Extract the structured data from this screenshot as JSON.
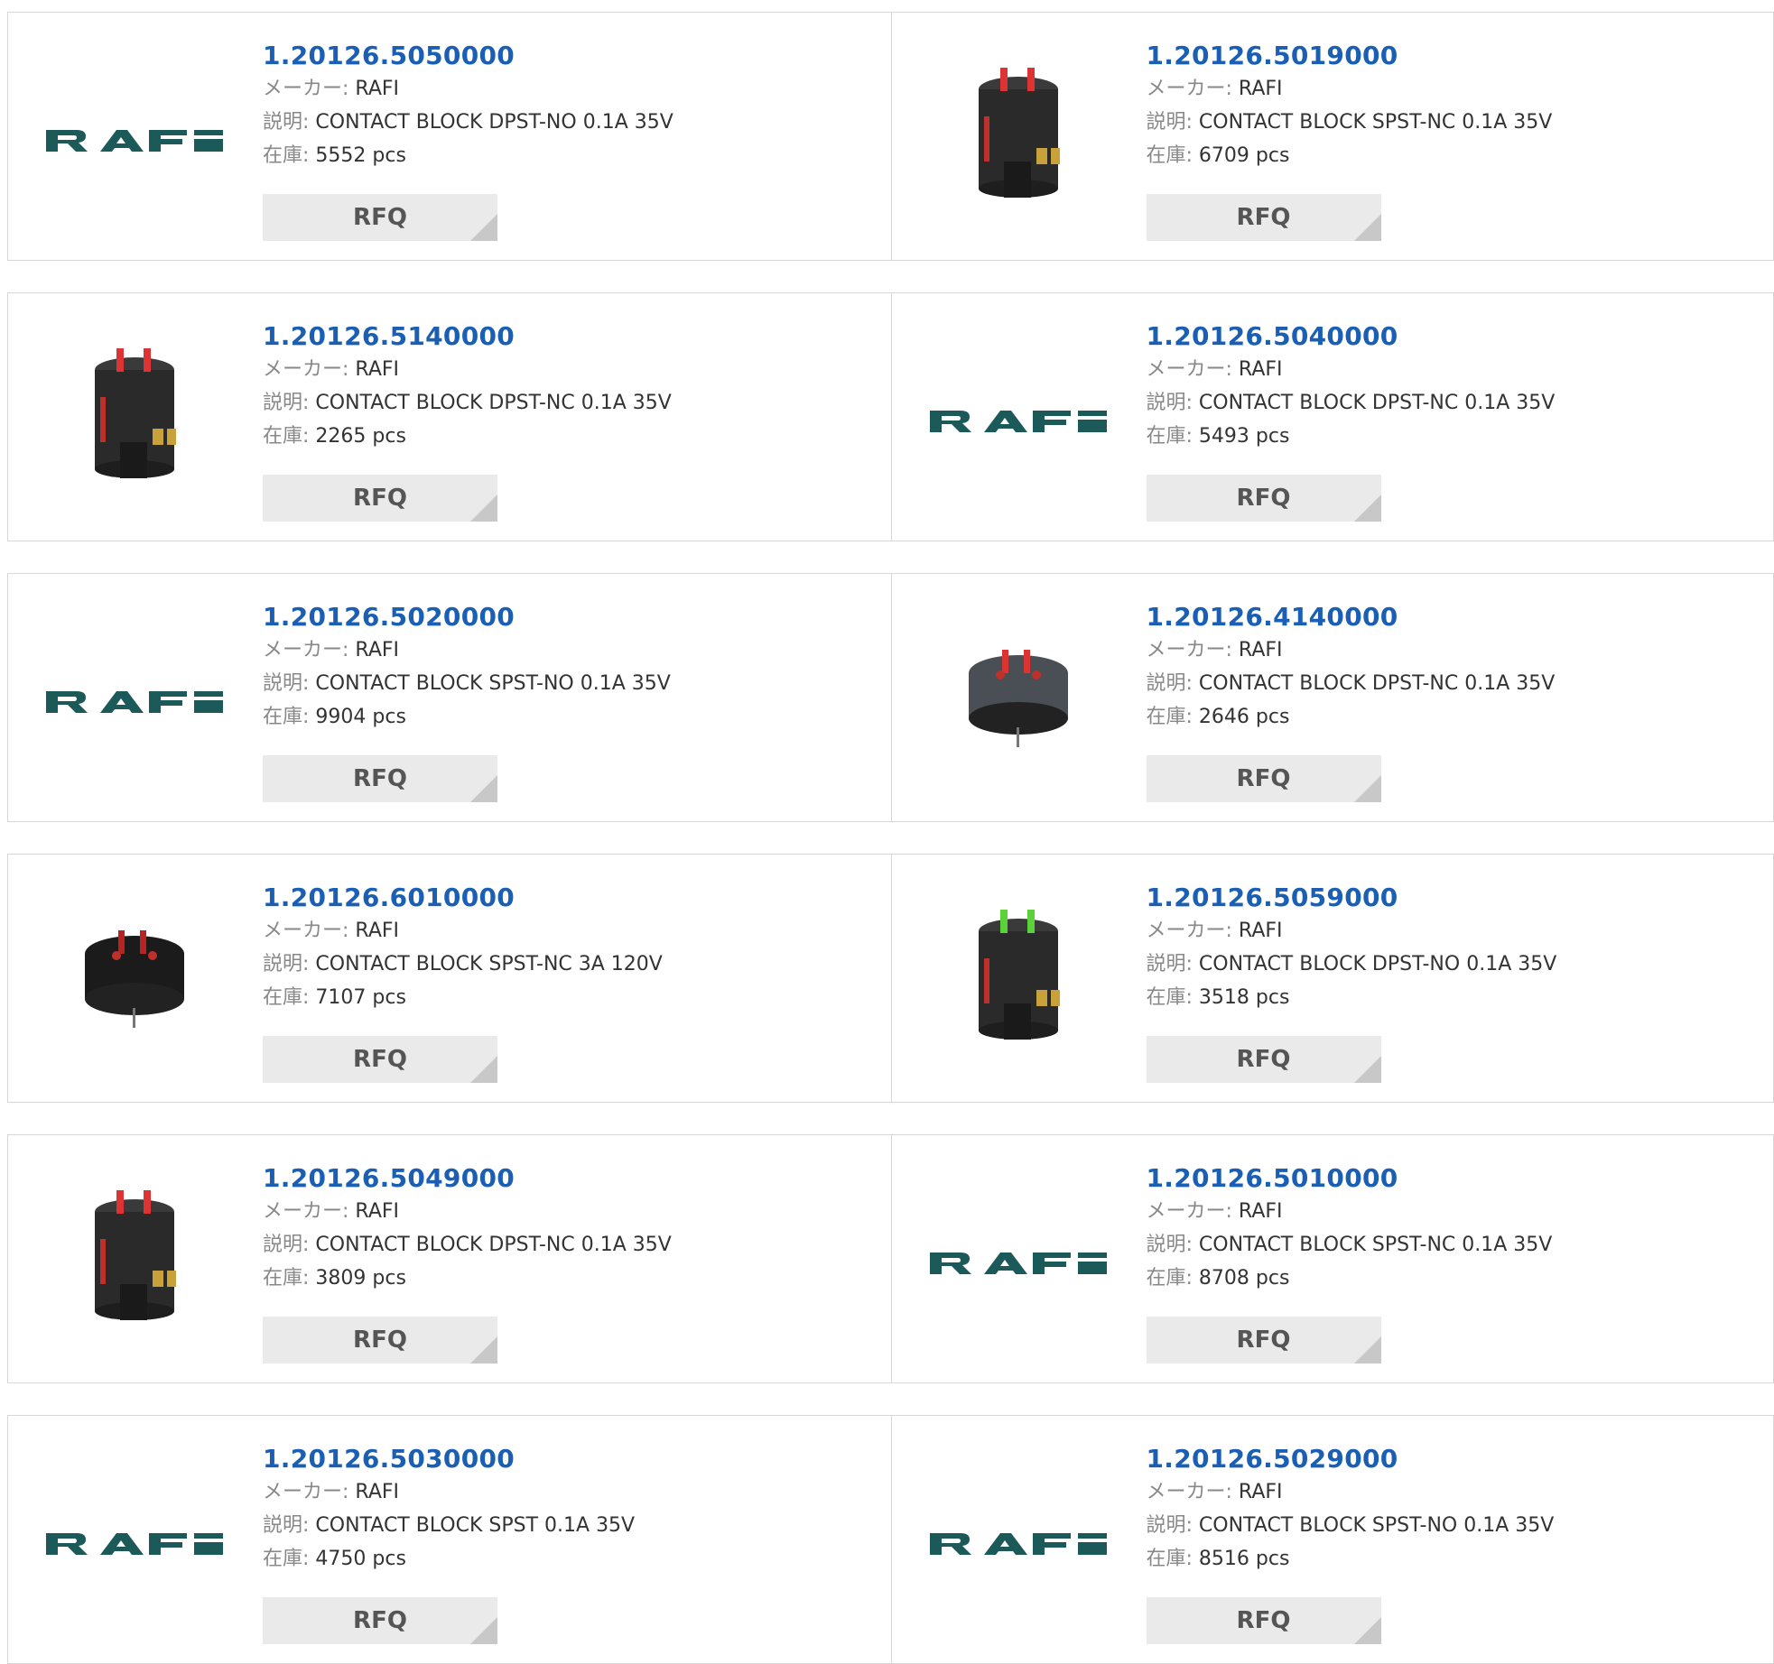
{
  "labels": {
    "maker": "メーカー:",
    "desc": "説明:",
    "stock": "在庫:",
    "rfq": "RFQ"
  },
  "colors": {
    "link": "#1a5fb4",
    "logo": "#1c5a5a",
    "rfq_bg": "#eaeaea"
  },
  "products": [
    {
      "pn": "1.20126.5050000",
      "maker": "RAFI",
      "desc": "CONTACT BLOCK DPST-NO 0.1A 35V",
      "stock": "5552 pcs",
      "image": "rafi-logo"
    },
    {
      "pn": "1.20126.5019000",
      "maker": "RAFI",
      "desc": "CONTACT BLOCK SPST-NC 0.1A 35V",
      "stock": "6709 pcs",
      "image": "contact-block-tall-red"
    },
    {
      "pn": "1.20126.5140000",
      "maker": "RAFI",
      "desc": "CONTACT BLOCK DPST-NC 0.1A 35V",
      "stock": "2265 pcs",
      "image": "contact-block-tall-red"
    },
    {
      "pn": "1.20126.5040000",
      "maker": "RAFI",
      "desc": "CONTACT BLOCK DPST-NC 0.1A 35V",
      "stock": "5493 pcs",
      "image": "rafi-logo"
    },
    {
      "pn": "1.20126.5020000",
      "maker": "RAFI",
      "desc": "CONTACT BLOCK SPST-NO 0.1A 35V",
      "stock": "9904 pcs",
      "image": "rafi-logo"
    },
    {
      "pn": "1.20126.4140000",
      "maker": "RAFI",
      "desc": "CONTACT BLOCK DPST-NC 0.1A 35V",
      "stock": "2646 pcs",
      "image": "contact-block-round-grey"
    },
    {
      "pn": "1.20126.6010000",
      "maker": "RAFI",
      "desc": "CONTACT BLOCK SPST-NC 3A 120V",
      "stock": "7107 pcs",
      "image": "contact-block-round-black"
    },
    {
      "pn": "1.20126.5059000",
      "maker": "RAFI",
      "desc": "CONTACT BLOCK DPST-NO 0.1A 35V",
      "stock": "3518 pcs",
      "image": "contact-block-tall-green"
    },
    {
      "pn": "1.20126.5049000",
      "maker": "RAFI",
      "desc": "CONTACT BLOCK DPST-NC 0.1A 35V",
      "stock": "3809 pcs",
      "image": "contact-block-tall-red"
    },
    {
      "pn": "1.20126.5010000",
      "maker": "RAFI",
      "desc": "CONTACT BLOCK SPST-NC 0.1A 35V",
      "stock": "8708 pcs",
      "image": "rafi-logo"
    },
    {
      "pn": "1.20126.5030000",
      "maker": "RAFI",
      "desc": "CONTACT BLOCK SPST 0.1A 35V",
      "stock": "4750 pcs",
      "image": "rafi-logo"
    },
    {
      "pn": "1.20126.5029000",
      "maker": "RAFI",
      "desc": "CONTACT BLOCK SPST-NO 0.1A 35V",
      "stock": "8516 pcs",
      "image": "rafi-logo"
    }
  ]
}
